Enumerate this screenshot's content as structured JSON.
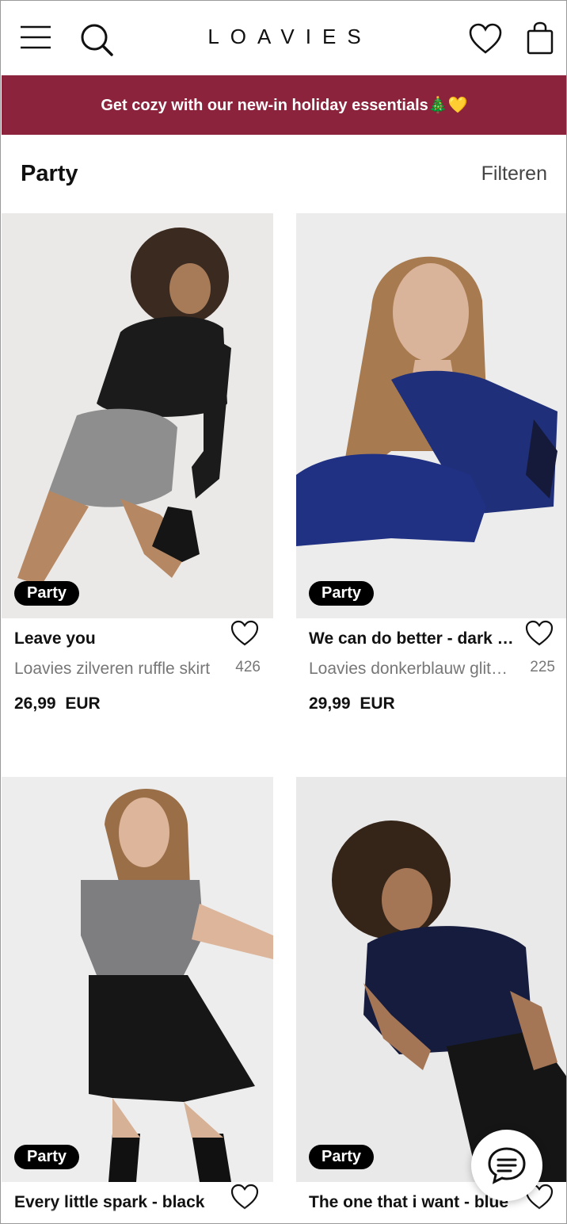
{
  "header": {
    "logo": "LOAVIES",
    "icons": [
      "menu-icon",
      "search-icon",
      "heart-icon",
      "bag-icon"
    ]
  },
  "banner": {
    "text": "Get cozy with our new-in holiday essentials🎄💛",
    "background": "#8a233b"
  },
  "category": {
    "title": "Party",
    "filter_label": "Filteren"
  },
  "products": [
    {
      "tag": "Party",
      "name": "Leave you",
      "subtitle": "Loavies zilveren ruffle skirt",
      "price": "26,99 EUR",
      "favorites": "426"
    },
    {
      "tag": "Party",
      "name": "We can do better - dark blue",
      "subtitle": "Loavies donkerblauw glitter top",
      "price": "29,99 EUR",
      "favorites": "225"
    },
    {
      "tag": "Party",
      "name": "Every little spark - black",
      "subtitle": "",
      "price": "",
      "favorites": ""
    },
    {
      "tag": "Party",
      "name": "The one that i want - blue",
      "subtitle": "",
      "price": "",
      "favorites": ""
    }
  ],
  "chat": {
    "icon": "chat-icon"
  }
}
